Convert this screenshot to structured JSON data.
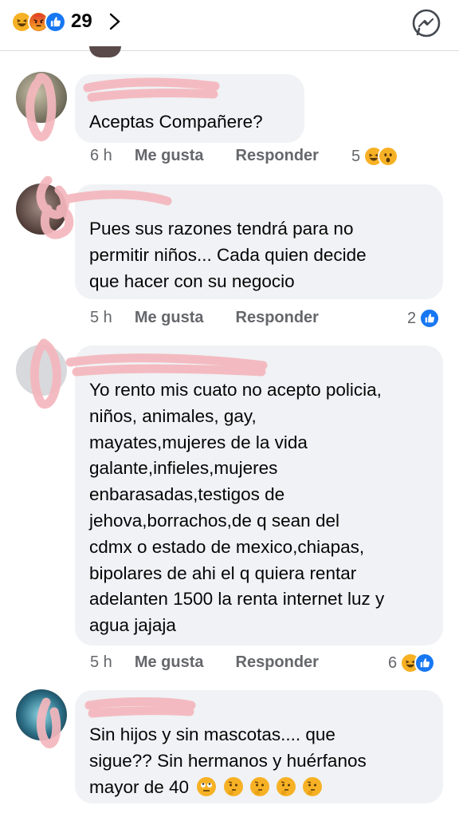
{
  "header": {
    "reactions": [
      "haha",
      "angry",
      "like"
    ],
    "reaction_count": "29",
    "chevron_icon": "chevron-right",
    "messenger_icon": "messenger"
  },
  "comments": [
    {
      "text": "Aceptas Compañere?",
      "time": "6 h",
      "like_label": "Me gusta",
      "reply_label": "Responder",
      "reaction_count": "5",
      "reactions": [
        "haha",
        "wow"
      ]
    },
    {
      "text": "Pues sus razones tendrá para no\npermitir niños... Cada quien decide\nque hacer con su negocio",
      "time": "5 h",
      "like_label": "Me gusta",
      "reply_label": "Responder",
      "reaction_count": "2",
      "reactions": [
        "like"
      ]
    },
    {
      "text": "Yo rento mis cuato no acepto policia,\nniños, animales, gay,\nmayates,mujeres de la vida\ngalante,infieles,mujeres\nenbarasadas,testigos de\njehova,borrachos,de  q sean del\ncdmx o estado de mexico,chiapas,\nbipolares de ahi el q quiera rentar\nadelanten 1500 la renta internet luz y\nagua jajaja",
      "time": "5 h",
      "like_label": "Me gusta",
      "reply_label": "Responder",
      "reaction_count": "6",
      "reactions": [
        "haha",
        "like"
      ]
    },
    {
      "text_line1": "Sin hijos y sin mascotas.... que",
      "text_line2": "sigue?? Sin hermanos y huérfanos",
      "text_line3": "mayor de 40",
      "emojis": [
        "face-with-rolling-eyes",
        "thinking-face",
        "thinking-face",
        "thinking-face",
        "thinking-face"
      ]
    }
  ],
  "colors": {
    "bubble": "#f0f2f5",
    "secondary_text": "#65676b",
    "like_blue": "#1877f2",
    "haha_yellow": "#f7b125",
    "angry_orange": "#e9710f",
    "scribble_pink": "#f4b7bd"
  }
}
